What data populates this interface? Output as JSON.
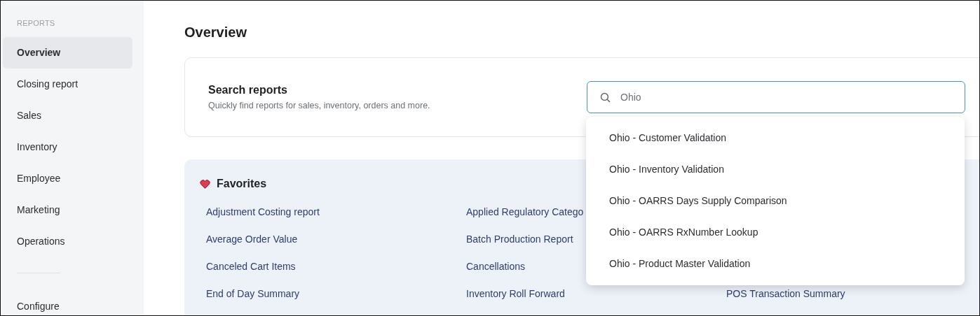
{
  "sidebar": {
    "section_label": "REPORTS",
    "items": [
      {
        "label": "Overview",
        "selected": true
      },
      {
        "label": "Closing report",
        "selected": false
      },
      {
        "label": "Sales",
        "selected": false
      },
      {
        "label": "Inventory",
        "selected": false
      },
      {
        "label": "Employee",
        "selected": false
      },
      {
        "label": "Marketing",
        "selected": false
      },
      {
        "label": "Operations",
        "selected": false
      }
    ],
    "footer_items": [
      {
        "label": "Configure",
        "selected": false
      }
    ]
  },
  "page_title": "Overview",
  "search_card": {
    "title": "Search reports",
    "subtitle": "Quickly find reports for sales, inventory, orders and more.",
    "search": {
      "value": "Ohio",
      "focused": true
    },
    "suggestions": [
      "Ohio - Customer Validation",
      "Ohio - Inventory Validation",
      "Ohio - OARRS Days Supply Comparison",
      "Ohio - OARRS RxNumber Lookup",
      "Ohio - Product Master Validation"
    ]
  },
  "favorites": {
    "title": "Favorites",
    "rows": [
      [
        "Adjustment Costing report",
        "Applied Regulatory Catego"
      ],
      [
        "Average Order Value",
        "Batch Production Report"
      ],
      [
        "Canceled Cart Items",
        "Cancellations"
      ],
      [
        "End of Day Summary",
        "Inventory Roll Forward",
        "POS Transaction Summary"
      ]
    ]
  }
}
